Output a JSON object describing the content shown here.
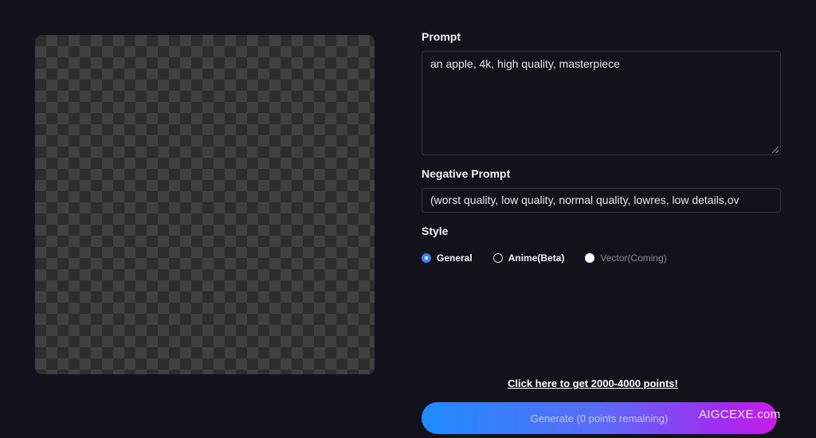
{
  "form": {
    "prompt_label": "Prompt",
    "prompt_value": "an apple, 4k, high quality, masterpiece",
    "negative_label": "Negative Prompt",
    "negative_value": "(worst quality, low quality, normal quality, lowres, low details,ov",
    "style_label": "Style",
    "styles": [
      {
        "label": "General",
        "selected": true,
        "disabled": false
      },
      {
        "label": "Anime(Beta)",
        "selected": false,
        "disabled": false
      },
      {
        "label": "Vector(Coming)",
        "selected": false,
        "disabled": true
      }
    ],
    "points_link": "Click here to get 2000-4000 points!",
    "generate_label": "Generate (0 points remaining)"
  },
  "watermark": "AIGCEXE.com",
  "colors": {
    "background": "#13121c",
    "accent_blue": "#1e8cff",
    "accent_purple": "#c71ee8",
    "radio_selected": "#3a86e8"
  }
}
